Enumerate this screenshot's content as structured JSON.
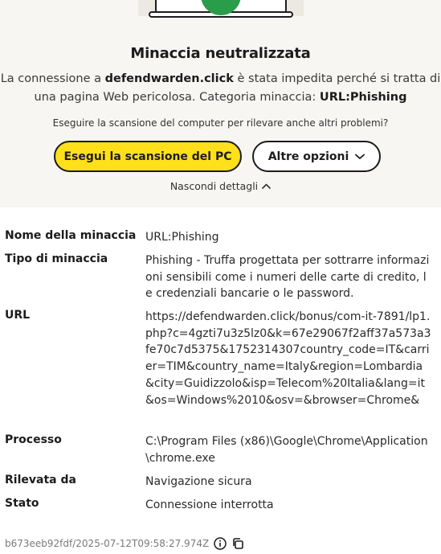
{
  "header": {
    "title": "Minaccia neutralizzata",
    "desc_part1": "La connessione a ",
    "domain": "defendwarden.click",
    "desc_part2": " è stata impedita perché si tratta di una pagina Web pericolosa. Categoria minaccia: ",
    "category": "URL:Phishing",
    "question": "Eseguire la scansione del computer per rilevare anche altri problemi?"
  },
  "actions": {
    "scan_label": "Esegui la scansione del PC",
    "more_label": "Altre opzioni",
    "hide_label": "Nascondi dettagli"
  },
  "details": [
    {
      "key": "Nome della minaccia",
      "value": "URL:Phishing"
    },
    {
      "key": "Tipo di minaccia",
      "value": "Phishing - Truffa progettata per sottrarre informazioni sensibili come i numeri delle carte di credito, le credenziali bancarie o le password."
    },
    {
      "key": "URL",
      "value": "https://defendwarden.click/bonus/com-it-7891/lp1.php?c=4gzti7u3z5lz0&k=67e29067f2aff37a573a3fe70c7d5375&1752314307country_code=IT&carrier=TIM&country_name=Italy&region=Lombardia&city=Guidizzolo&isp=Telecom%20Italia&lang=it&os=Windows%2010&osv=&browser=Chrome&"
    },
    {
      "key": "Processo",
      "value": "C:\\Program Files (x86)\\Google\\Chrome\\Application\\chrome.exe"
    },
    {
      "key": "Rilevata da",
      "value": "Navigazione sicura"
    },
    {
      "key": "Stato",
      "value": "Connessione interrotta"
    }
  ],
  "footer": {
    "id": "b673eeb92fdf/2025-07-12T09:58:27.974Z"
  },
  "colors": {
    "accent": "#ffe01b",
    "background": "#f7f6f3",
    "shield": "#2a9d4a"
  },
  "icons": [
    "laptop-shield-illustration",
    "chevron-down-icon",
    "chevron-up-icon",
    "info-icon",
    "copy-icon"
  ]
}
